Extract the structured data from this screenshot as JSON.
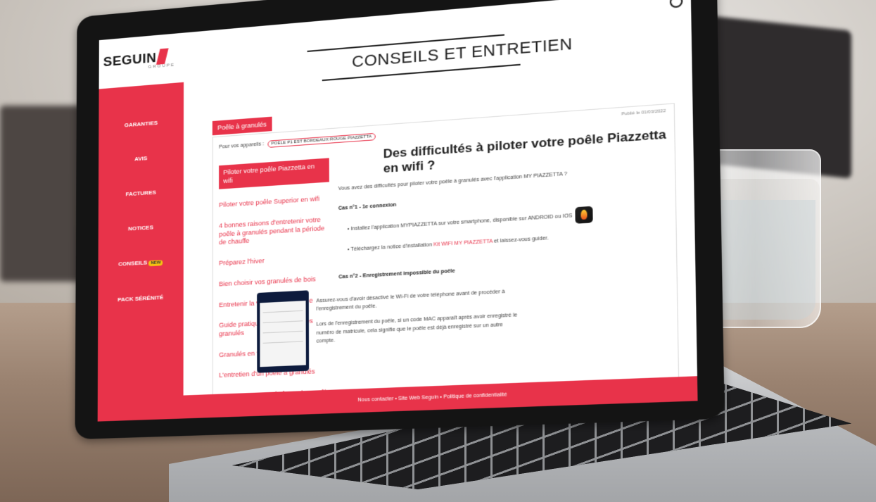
{
  "brand": {
    "logo_text": "SEGUIN",
    "logo_sub": "GROUPE"
  },
  "page_title": "CONSEILS ET ENTRETIEN",
  "sidebar": {
    "items": [
      {
        "label": "GARANTIES"
      },
      {
        "label": "AVIS"
      },
      {
        "label": "FACTURES"
      },
      {
        "label": "NOTICES"
      },
      {
        "label": "CONSEILS",
        "badge": "NEW"
      },
      {
        "label": "PACK SÉRÉNITÉ"
      }
    ]
  },
  "tab": {
    "label": "Poêle à granulés"
  },
  "appliance": {
    "label": "Pour vos appareils :",
    "selected": "POELE P1 EST BORDEAUX ROUGE PIAZZETTA"
  },
  "updated": "Publié le 01/03/2022",
  "menu": [
    "Piloter votre poêle Piazzetta en wifi",
    "Piloter votre poêle Superior en wifi",
    "4 bonnes raisons d'entretenir votre poêle à granulés pendant la période de chauffe",
    "Préparez l'hiver",
    "Bien choisir vos granulés de bois",
    "Entretenir la vitre de votre poêle",
    "Guide pratique pour stocker ses granulés",
    "Granulés en vrac ou en sac ?",
    "L'entretien d'un poêle à granulés",
    "Comment nettoyer le foyer d'un poêle à granulés ?"
  ],
  "article": {
    "title": "Des difficultés à piloter votre poêle Piazzetta en wifi ?",
    "intro": "Vous avez des difficultés pour piloter votre poêle à granulés avec l'application MY PIAZZETTA ?",
    "case1_title": "Cas n°1 - 1e connexion",
    "case1_b1": "Installez l'application MYPIAZZETTA sur votre smartphone, disponible sur ANDROID ou IOS",
    "case1_b2_pre": "Téléchargez la notice d'installation",
    "case1_b2_link": "Kit WIFI MY PIAZZETTA",
    "case1_b2_post": "et laissez-vous guider.",
    "case2_title": "Cas n°2 - Enregistrement impossible du poêle",
    "case2_p1": "Assurez-vous d'avoir désactivé le Wi-Fi de votre téléphone avant de procéder à l'enregistrement du poêle.",
    "case2_p2": "Lors de l'enregistrement du poêle, si un code MAC apparaît après avoir enregistré le numéro de matricule, cela signifie que le poêle est déjà enregistré sur un autre compte."
  },
  "footer": "Nous contacter • Site Web Seguin • Politique de confidentialité"
}
